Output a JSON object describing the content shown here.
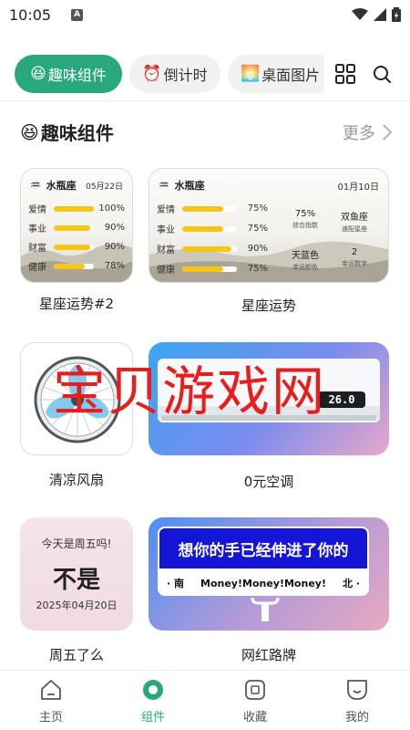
{
  "status": {
    "time": "10:05",
    "a_icon": "A"
  },
  "tabs": [
    {
      "emoji": "😆",
      "label": "趣味组件",
      "active": true
    },
    {
      "emoji": "⏰",
      "label": "倒计时",
      "active": false
    },
    {
      "emoji": "🌅",
      "label": "桌面图片",
      "active": false
    }
  ],
  "section": {
    "emoji": "😆",
    "title": "趣味组件",
    "more": "更多"
  },
  "horoscope_small": {
    "sign": "水瓶座",
    "date": "05月22日",
    "rows": [
      {
        "label": "爱情",
        "value": "100%",
        "fraction": 1.0
      },
      {
        "label": "事业",
        "value": "90%",
        "fraction": 0.9
      },
      {
        "label": "财富",
        "value": "90%",
        "fraction": 0.9
      },
      {
        "label": "健康",
        "value": "78%",
        "fraction": 0.78
      }
    ],
    "caption": "星座运势#2"
  },
  "horoscope_large": {
    "sign": "水瓶座",
    "date": "01月10日",
    "rows": [
      {
        "label": "爱情",
        "value": "75%",
        "fraction": 0.75
      },
      {
        "label": "事业",
        "value": "75%",
        "fraction": 0.75
      },
      {
        "label": "财富",
        "value": "90%",
        "fraction": 0.9
      },
      {
        "label": "健康",
        "value": "75%",
        "fraction": 0.75
      }
    ],
    "stats": [
      {
        "value": "75%",
        "label": "综合指数"
      },
      {
        "value": "双鱼座",
        "label": "速配星座"
      },
      {
        "value": "天蓝色",
        "label": "幸运颜色"
      },
      {
        "value": "2",
        "label": "幸运数字"
      }
    ],
    "caption": "星座运势"
  },
  "fan": {
    "caption": "清凉风扇"
  },
  "ac": {
    "display": "26.0",
    "caption": "0元空调"
  },
  "friday": {
    "line1": "今天是周五吗!",
    "line2": "不是",
    "line3": "2025年04月20日",
    "caption": "周五了么"
  },
  "road_sign": {
    "top_text": "想你的手已经伸进了你的",
    "left": "· 南",
    "middle": "Money!Money!Money!",
    "right": "北 ·",
    "caption": "网红路牌"
  },
  "watermark": "宝贝游戏网",
  "bottom_nav": [
    {
      "label": "主页",
      "icon": "home-icon",
      "active": false
    },
    {
      "label": "组件",
      "icon": "widget-icon",
      "active": true
    },
    {
      "label": "收藏",
      "icon": "favorite-icon",
      "active": false
    },
    {
      "label": "我的",
      "icon": "profile-icon",
      "active": false
    }
  ],
  "colors": {
    "accent": "#2aa87d",
    "bar": "#f5c518",
    "watermark": "#e81e1e",
    "sign_blue": "#1515d8"
  }
}
